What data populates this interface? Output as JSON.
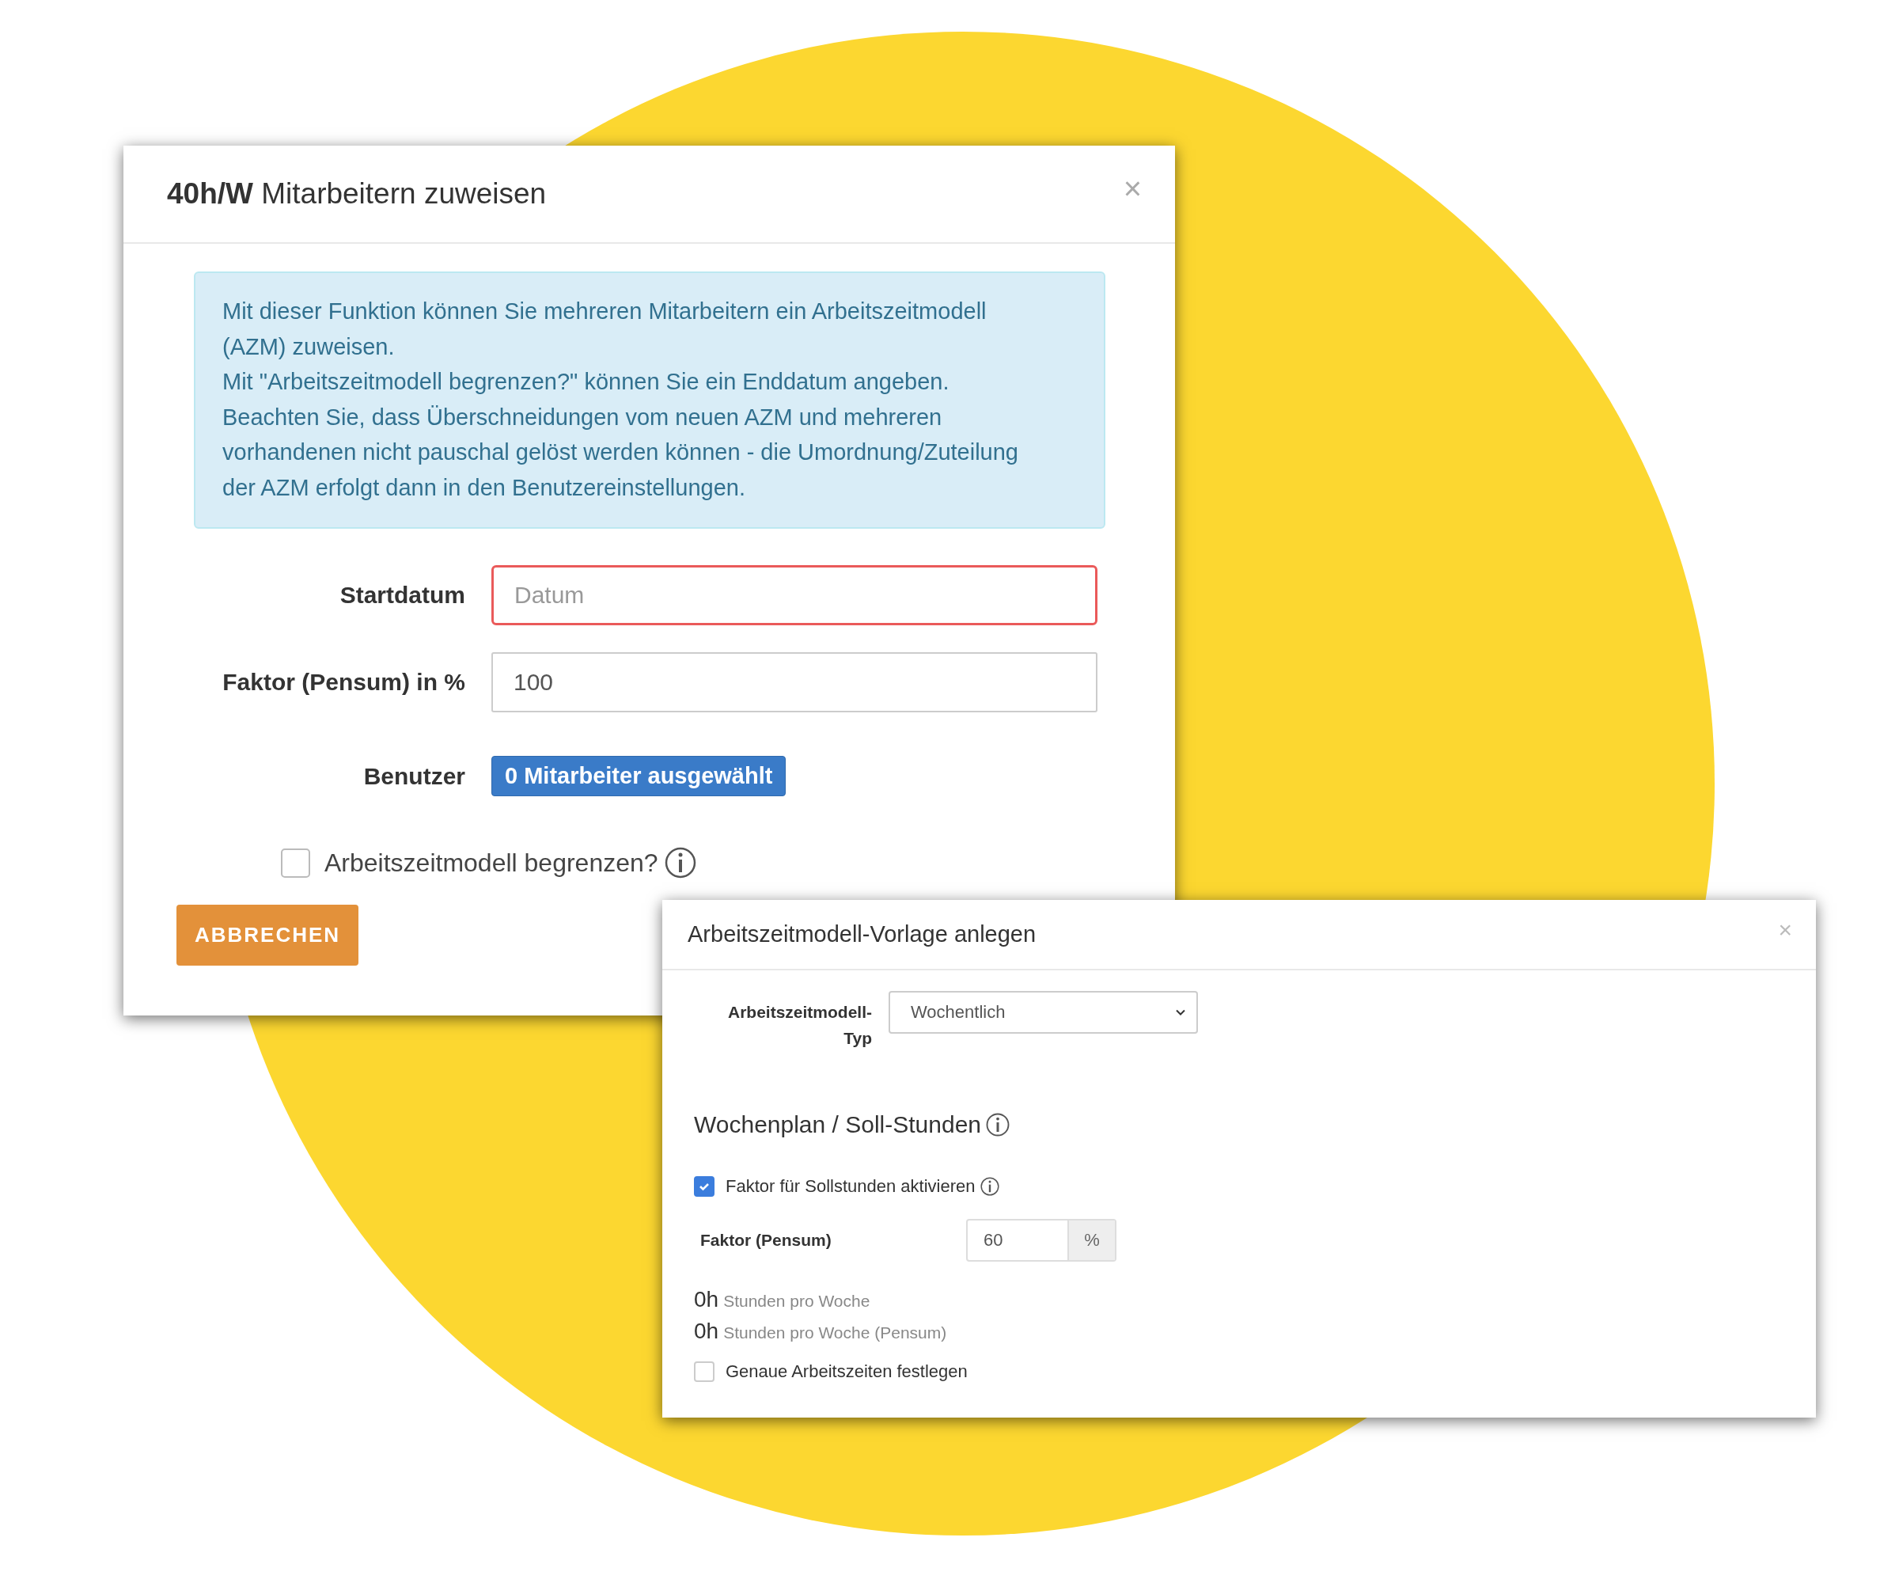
{
  "assign_dialog": {
    "title": "**40h/W** Mitarbeitern zuweisen",
    "close": "×",
    "info": [
      "Mit dieser Funktion können Sie mehreren Mitarbeitern ein Arbeitszeitmodell (AZM) zuweisen.",
      "Mit \"Arbeitszeitmodell begrenzen?\" können Sie ein Enddatum angeben.",
      "Beachten Sie, dass Überschneidungen vom neuen AZM und mehreren vorhandenen nicht pauschal gelöst werden können - die Umordnung/Zuteilung der AZM erfolgt dann in den Benutzereinstellungen."
    ],
    "fields": [
      {
        "kind": "input",
        "label": "Startdatum",
        "placeholder": "Datum",
        "invalid": true
      },
      {
        "kind": "input",
        "label": "Faktor (Pensum) in %",
        "value": "100",
        "invalid": false
      },
      {
        "kind": "button",
        "label": "Benutzer",
        "button": "0 Mitarbeiter ausgewählt"
      }
    ],
    "limit_checkbox": {
      "label": "Arbeitszeitmodell begrenzen?",
      "checked": false
    },
    "cancel_button": "ABBRECHEN"
  },
  "template_dialog": {
    "title": "Arbeitszeitmodell-Vorlage anlegen",
    "close": "×",
    "type_label": "Arbeitszeitmodell-Typ",
    "type_value": "Wochentlich",
    "section_title": "Wochenplan / Soll-Stunden",
    "factor_checkbox": {
      "label": "Faktor für Sollstunden aktivieren",
      "checked": true
    },
    "factor_label": "Faktor (Pensum)",
    "factor_value": "60",
    "factor_unit": "%",
    "totals": [
      {
        "hours": "0h",
        "description": "Stunden pro Woche"
      },
      {
        "hours": "0h",
        "description": "Stunden pro Woche (Pensum)"
      }
    ],
    "exact_checkbox": {
      "label": "Genaue Arbeitszeiten festlegen",
      "checked": false
    }
  }
}
